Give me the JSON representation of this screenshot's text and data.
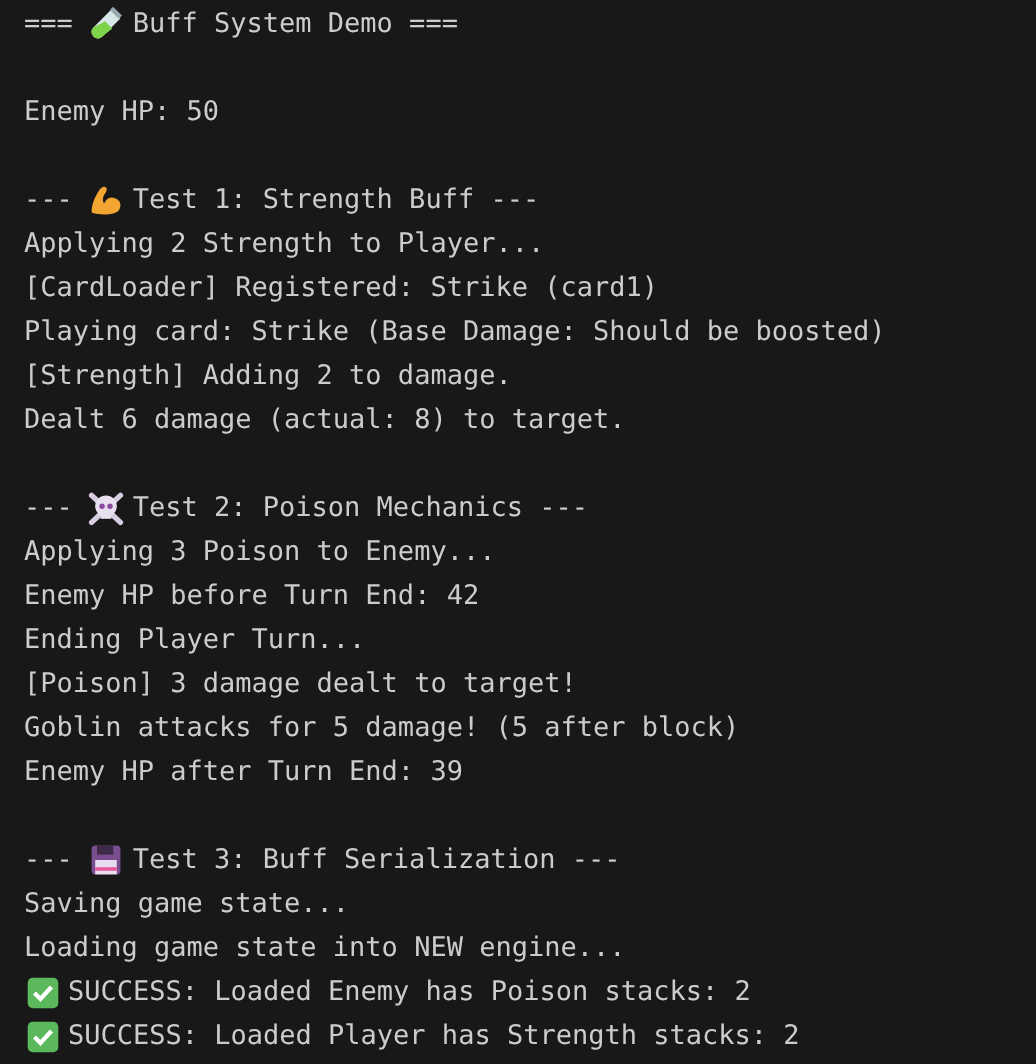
{
  "terminal": {
    "blocks": [
      [
        {
          "kind": "header",
          "prefix": "===",
          "text": "Buff System Demo ==="
        }
      ],
      [
        {
          "kind": "plain",
          "text": "Enemy HP: 50"
        }
      ],
      [
        {
          "kind": "header",
          "prefix": "---",
          "text": "Test 1: Strength Buff ---"
        },
        {
          "kind": "plain",
          "text": "Applying 2 Strength to Player..."
        },
        {
          "kind": "plain",
          "text": "[CardLoader] Registered: Strike (card1)"
        },
        {
          "kind": "plain",
          "text": "Playing card: Strike (Base Damage: Should be boosted)"
        },
        {
          "kind": "plain",
          "text": "[Strength] Adding 2 to damage."
        },
        {
          "kind": "plain",
          "text": "Dealt 6 damage (actual: 8) to target."
        }
      ],
      [
        {
          "kind": "header",
          "prefix": "---",
          "text": "Test 2: Poison Mechanics ---"
        },
        {
          "kind": "plain",
          "text": "Applying 3 Poison to Enemy..."
        },
        {
          "kind": "plain",
          "text": "Enemy HP before Turn End: 42"
        },
        {
          "kind": "plain",
          "text": "Ending Player Turn..."
        },
        {
          "kind": "plain",
          "text": "[Poison] 3 damage dealt to target!"
        },
        {
          "kind": "plain",
          "text": "Goblin attacks for 5 damage! (5 after block)"
        },
        {
          "kind": "plain",
          "text": "Enemy HP after Turn End: 39"
        }
      ],
      [
        {
          "kind": "header",
          "prefix": "---",
          "text": "Test 3: Buff Serialization ---"
        },
        {
          "kind": "plain",
          "text": "Saving game state..."
        },
        {
          "kind": "plain",
          "text": "Loading game state into NEW engine..."
        },
        {
          "kind": "success",
          "text": "SUCCESS: Loaded Enemy has Poison stacks: 2"
        },
        {
          "kind": "success",
          "text": "SUCCESS: Loaded Player has Strength stacks: 2"
        }
      ]
    ]
  }
}
